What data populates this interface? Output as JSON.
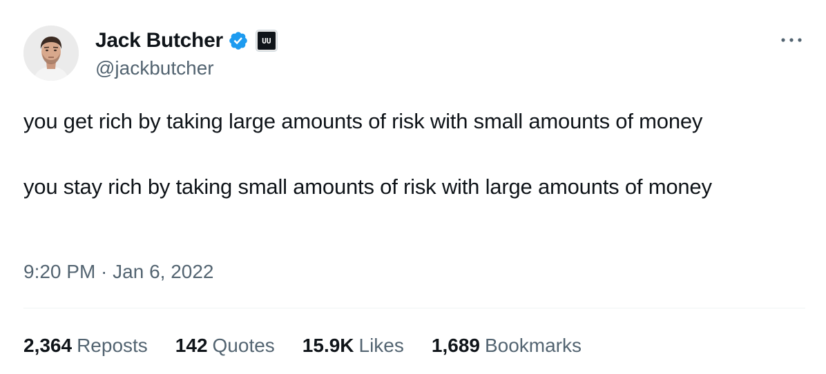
{
  "author": {
    "display_name": "Jack Butcher",
    "handle": "@jackbutcher",
    "verified": true,
    "affiliate_badge_text": "UU",
    "verified_color": "#1d9bf0"
  },
  "tweet": {
    "paragraphs": [
      "you get rich by taking large amounts of risk with small amounts of money",
      "you stay rich by taking small amounts of risk with large amounts of money"
    ],
    "timestamp": "9:20 PM · Jan 6, 2022"
  },
  "stats": {
    "reposts": {
      "count": "2,364",
      "label": "Reposts"
    },
    "quotes": {
      "count": "142",
      "label": "Quotes"
    },
    "likes": {
      "count": "15.9K",
      "label": "Likes"
    },
    "bookmarks": {
      "count": "1,689",
      "label": "Bookmarks"
    }
  },
  "icons": {
    "more": "more-horizontal-icon",
    "verified": "verified-badge-icon"
  },
  "colors": {
    "text_primary": "#0f1419",
    "text_secondary": "#536471",
    "divider": "#eff3f4"
  }
}
